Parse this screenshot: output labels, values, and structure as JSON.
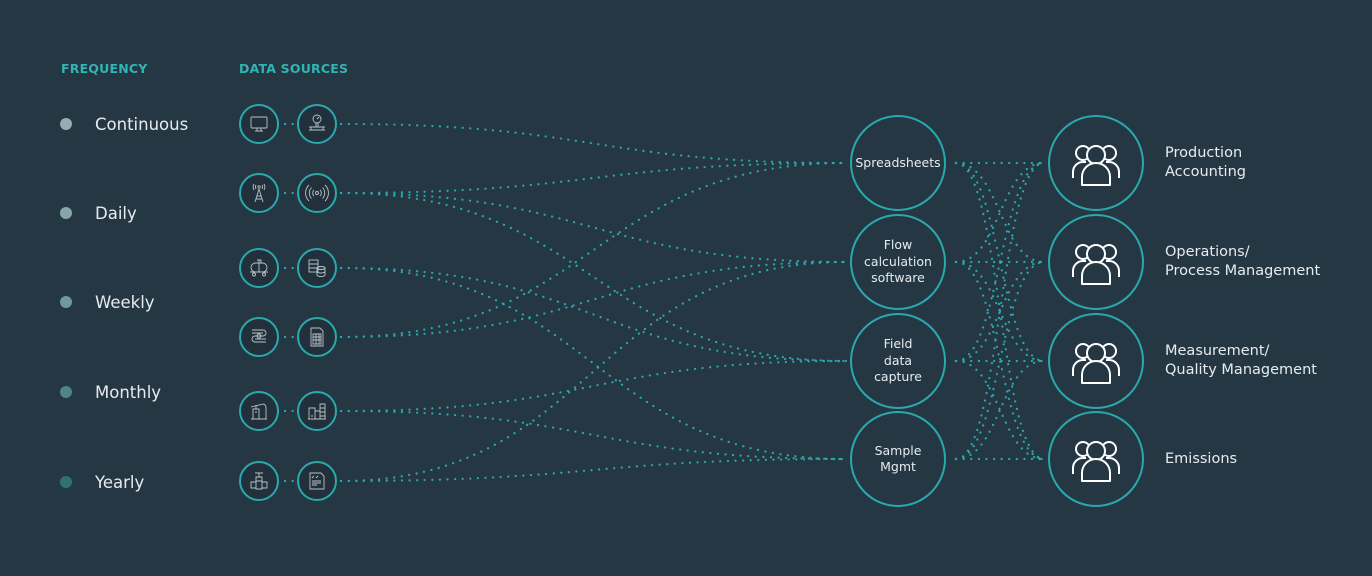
{
  "headers": {
    "frequency": "FREQUENCY",
    "data_sources": "DATA SOURCES"
  },
  "colors": {
    "background": "#263744",
    "accent": "#2aa9ad",
    "header_text": "#2fb5b5",
    "text": "#e6ecee"
  },
  "frequencies": [
    {
      "label": "Continuous",
      "dot_color": "#94aeb1"
    },
    {
      "label": "Daily",
      "dot_color": "#86a6aa"
    },
    {
      "label": "Weekly",
      "dot_color": "#6f9a9d"
    },
    {
      "label": "Monthly",
      "dot_color": "#4f8587"
    },
    {
      "label": "Yearly",
      "dot_color": "#2f7274"
    }
  ],
  "sources": [
    {
      "icons": [
        "monitor-icon",
        "pressure-gauge-icon"
      ]
    },
    {
      "icons": [
        "radio-tower-icon",
        "wireless-signal-icon"
      ]
    },
    {
      "icons": [
        "tank-car-icon",
        "database-server-icon"
      ]
    },
    {
      "icons": [
        "pipeline-icon",
        "spreadsheet-file-icon"
      ]
    },
    {
      "icons": [
        "pump-jack-icon",
        "industrial-plant-icon"
      ]
    },
    {
      "icons": [
        "valve-icon",
        "report-document-icon"
      ]
    }
  ],
  "hubs": [
    {
      "label": "Spreadsheets"
    },
    {
      "label": "Flow\ncalculation\nsoftware"
    },
    {
      "label": "Field\ndata\ncapture"
    },
    {
      "label": "Sample\nMgmt"
    }
  ],
  "audiences": [
    {
      "label": "Production\nAccounting",
      "icon": "user-group-icon"
    },
    {
      "label": "Operations/\nProcess Management",
      "icon": "user-group-icon"
    },
    {
      "label": "Measurement/\nQuality Management",
      "icon": "user-group-icon"
    },
    {
      "label": "Emissions",
      "icon": "user-group-icon"
    }
  ],
  "source_to_hub_links": [
    {
      "source": 0,
      "hub": 0
    },
    {
      "source": 1,
      "hub": 0
    },
    {
      "source": 1,
      "hub": 1
    },
    {
      "source": 1,
      "hub": 2
    },
    {
      "source": 2,
      "hub": 2
    },
    {
      "source": 2,
      "hub": 3
    },
    {
      "source": 3,
      "hub": 0
    },
    {
      "source": 3,
      "hub": 1
    },
    {
      "source": 4,
      "hub": 2
    },
    {
      "source": 4,
      "hub": 3
    },
    {
      "source": 5,
      "hub": 1
    },
    {
      "source": 5,
      "hub": 3
    }
  ],
  "hub_to_audience_links": "all-to-all"
}
